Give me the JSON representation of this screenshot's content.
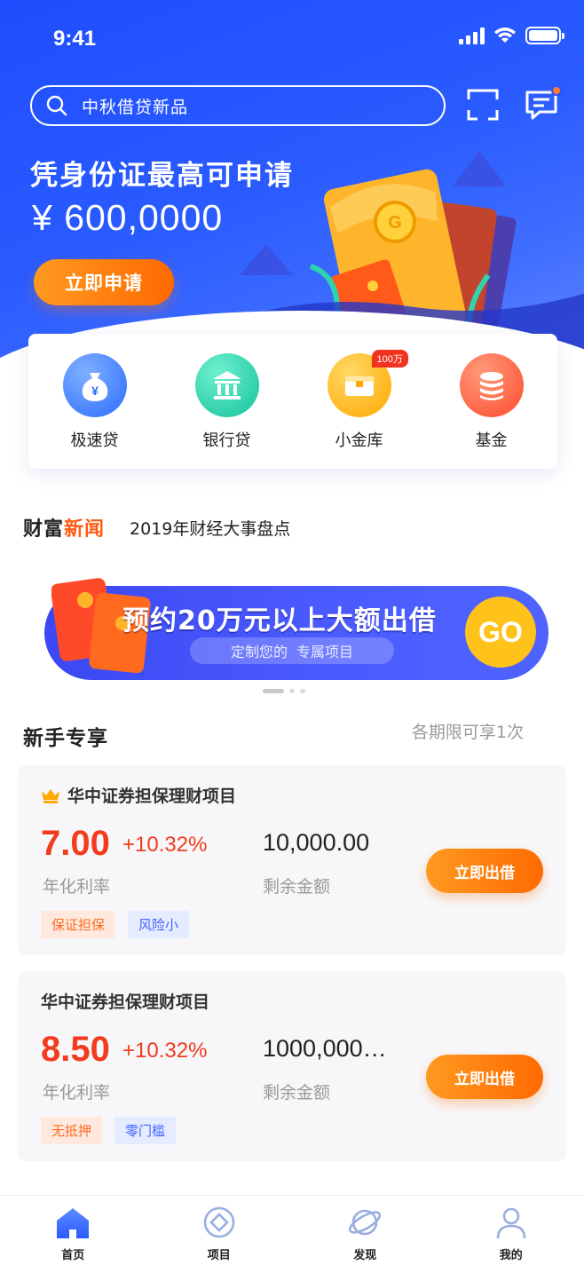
{
  "status_bar": {
    "time": "9:41"
  },
  "header": {
    "search_placeholder": "中秋借贷新品",
    "icons": [
      "scan-icon",
      "message-icon"
    ]
  },
  "hero": {
    "title": "凭身份证最高可申请",
    "amount": "¥ 600,0000",
    "apply_button": "立即申请"
  },
  "categories": [
    {
      "label": "极速贷",
      "icon": "money-bag-icon",
      "color": "#3f7bff"
    },
    {
      "label": "银行贷",
      "icon": "bank-icon",
      "color": "#1fd0b0"
    },
    {
      "label": "小金库",
      "icon": "treasure-box-icon",
      "color": "#ffb400",
      "badge": "100万"
    },
    {
      "label": "基金",
      "icon": "coins-icon",
      "color": "#ff5a3c"
    }
  ],
  "news": {
    "brand_part1": "财富",
    "brand_part2": "新闻",
    "headline": "2019年财经大事盘点"
  },
  "banner": {
    "title": "预约20万元以上大额出借",
    "subtitle_part1": "定制您的",
    "subtitle_part2": "专属项目",
    "go_button": "GO"
  },
  "section": {
    "title": "新手专享",
    "note": "各期限可享1次"
  },
  "products": [
    {
      "name": "华中证券担保理财项目",
      "rate": "7.00",
      "bonus": "+10.32%",
      "rate_label": "年化利率",
      "amount": "10,000.00",
      "amount_label": "剩余金额",
      "tags": [
        "保证担保",
        "风险小"
      ],
      "button": "立即出借"
    },
    {
      "name": "华中证券担保理财项目",
      "rate": "8.50",
      "bonus": "+10.32%",
      "rate_label": "年化利率",
      "amount": "1000,000…",
      "amount_label": "剩余金额",
      "tags": [
        "无抵押",
        "零门槛"
      ],
      "button": "立即出借"
    }
  ],
  "tabbar": [
    {
      "label": "首页",
      "icon": "home-icon",
      "active": true
    },
    {
      "label": "项目",
      "icon": "project-icon",
      "active": false
    },
    {
      "label": "发现",
      "icon": "discover-icon",
      "active": false
    },
    {
      "label": "我的",
      "icon": "profile-icon",
      "active": false
    }
  ],
  "colors": {
    "brand_blue": "#2a5bff",
    "accent_orange": "#ff6a00",
    "rate_red": "#f33b1d"
  }
}
